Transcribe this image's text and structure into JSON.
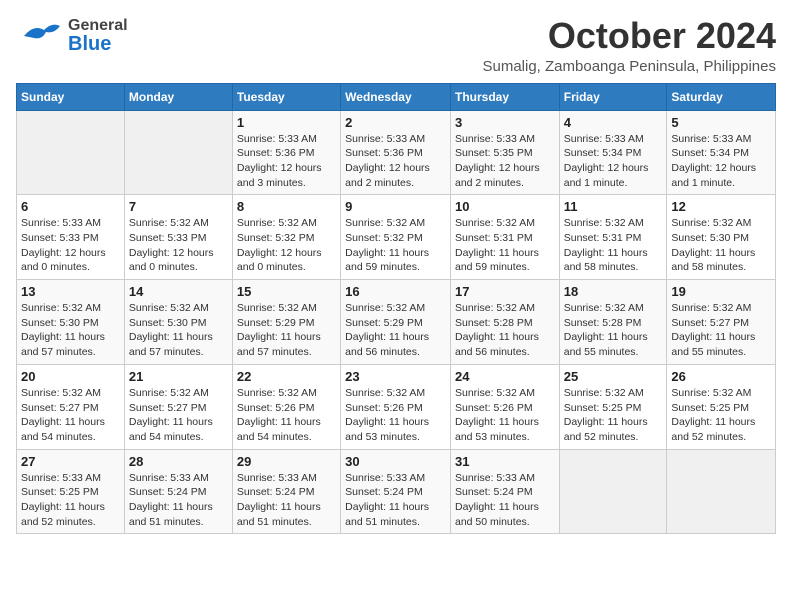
{
  "header": {
    "logo": {
      "line1": "General",
      "line2": "Blue"
    },
    "title": "October 2024",
    "subtitle": "Sumalig, Zamboanga Peninsula, Philippines"
  },
  "calendar": {
    "days_of_week": [
      "Sunday",
      "Monday",
      "Tuesday",
      "Wednesday",
      "Thursday",
      "Friday",
      "Saturday"
    ],
    "weeks": [
      [
        {
          "day": "",
          "info": ""
        },
        {
          "day": "",
          "info": ""
        },
        {
          "day": "1",
          "info": "Sunrise: 5:33 AM\nSunset: 5:36 PM\nDaylight: 12 hours\nand 3 minutes."
        },
        {
          "day": "2",
          "info": "Sunrise: 5:33 AM\nSunset: 5:36 PM\nDaylight: 12 hours\nand 2 minutes."
        },
        {
          "day": "3",
          "info": "Sunrise: 5:33 AM\nSunset: 5:35 PM\nDaylight: 12 hours\nand 2 minutes."
        },
        {
          "day": "4",
          "info": "Sunrise: 5:33 AM\nSunset: 5:34 PM\nDaylight: 12 hours\nand 1 minute."
        },
        {
          "day": "5",
          "info": "Sunrise: 5:33 AM\nSunset: 5:34 PM\nDaylight: 12 hours\nand 1 minute."
        }
      ],
      [
        {
          "day": "6",
          "info": "Sunrise: 5:33 AM\nSunset: 5:33 PM\nDaylight: 12 hours\nand 0 minutes."
        },
        {
          "day": "7",
          "info": "Sunrise: 5:32 AM\nSunset: 5:33 PM\nDaylight: 12 hours\nand 0 minutes."
        },
        {
          "day": "8",
          "info": "Sunrise: 5:32 AM\nSunset: 5:32 PM\nDaylight: 12 hours\nand 0 minutes."
        },
        {
          "day": "9",
          "info": "Sunrise: 5:32 AM\nSunset: 5:32 PM\nDaylight: 11 hours\nand 59 minutes."
        },
        {
          "day": "10",
          "info": "Sunrise: 5:32 AM\nSunset: 5:31 PM\nDaylight: 11 hours\nand 59 minutes."
        },
        {
          "day": "11",
          "info": "Sunrise: 5:32 AM\nSunset: 5:31 PM\nDaylight: 11 hours\nand 58 minutes."
        },
        {
          "day": "12",
          "info": "Sunrise: 5:32 AM\nSunset: 5:30 PM\nDaylight: 11 hours\nand 58 minutes."
        }
      ],
      [
        {
          "day": "13",
          "info": "Sunrise: 5:32 AM\nSunset: 5:30 PM\nDaylight: 11 hours\nand 57 minutes."
        },
        {
          "day": "14",
          "info": "Sunrise: 5:32 AM\nSunset: 5:30 PM\nDaylight: 11 hours\nand 57 minutes."
        },
        {
          "day": "15",
          "info": "Sunrise: 5:32 AM\nSunset: 5:29 PM\nDaylight: 11 hours\nand 57 minutes."
        },
        {
          "day": "16",
          "info": "Sunrise: 5:32 AM\nSunset: 5:29 PM\nDaylight: 11 hours\nand 56 minutes."
        },
        {
          "day": "17",
          "info": "Sunrise: 5:32 AM\nSunset: 5:28 PM\nDaylight: 11 hours\nand 56 minutes."
        },
        {
          "day": "18",
          "info": "Sunrise: 5:32 AM\nSunset: 5:28 PM\nDaylight: 11 hours\nand 55 minutes."
        },
        {
          "day": "19",
          "info": "Sunrise: 5:32 AM\nSunset: 5:27 PM\nDaylight: 11 hours\nand 55 minutes."
        }
      ],
      [
        {
          "day": "20",
          "info": "Sunrise: 5:32 AM\nSunset: 5:27 PM\nDaylight: 11 hours\nand 54 minutes."
        },
        {
          "day": "21",
          "info": "Sunrise: 5:32 AM\nSunset: 5:27 PM\nDaylight: 11 hours\nand 54 minutes."
        },
        {
          "day": "22",
          "info": "Sunrise: 5:32 AM\nSunset: 5:26 PM\nDaylight: 11 hours\nand 54 minutes."
        },
        {
          "day": "23",
          "info": "Sunrise: 5:32 AM\nSunset: 5:26 PM\nDaylight: 11 hours\nand 53 minutes."
        },
        {
          "day": "24",
          "info": "Sunrise: 5:32 AM\nSunset: 5:26 PM\nDaylight: 11 hours\nand 53 minutes."
        },
        {
          "day": "25",
          "info": "Sunrise: 5:32 AM\nSunset: 5:25 PM\nDaylight: 11 hours\nand 52 minutes."
        },
        {
          "day": "26",
          "info": "Sunrise: 5:32 AM\nSunset: 5:25 PM\nDaylight: 11 hours\nand 52 minutes."
        }
      ],
      [
        {
          "day": "27",
          "info": "Sunrise: 5:33 AM\nSunset: 5:25 PM\nDaylight: 11 hours\nand 52 minutes."
        },
        {
          "day": "28",
          "info": "Sunrise: 5:33 AM\nSunset: 5:24 PM\nDaylight: 11 hours\nand 51 minutes."
        },
        {
          "day": "29",
          "info": "Sunrise: 5:33 AM\nSunset: 5:24 PM\nDaylight: 11 hours\nand 51 minutes."
        },
        {
          "day": "30",
          "info": "Sunrise: 5:33 AM\nSunset: 5:24 PM\nDaylight: 11 hours\nand 51 minutes."
        },
        {
          "day": "31",
          "info": "Sunrise: 5:33 AM\nSunset: 5:24 PM\nDaylight: 11 hours\nand 50 minutes."
        },
        {
          "day": "",
          "info": ""
        },
        {
          "day": "",
          "info": ""
        }
      ]
    ]
  }
}
